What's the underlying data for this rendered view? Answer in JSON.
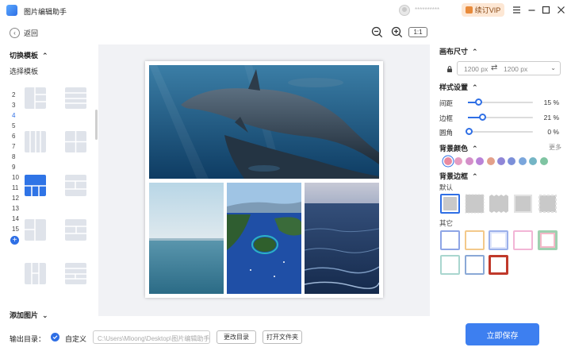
{
  "app": {
    "title": "图片编辑助手",
    "username": "**********",
    "vip_label": "续订VIP"
  },
  "toolbar": {
    "back_label": "返回",
    "ratio_label": "1:1"
  },
  "left_panel": {
    "switch_label": "切换模板",
    "select_label": "选择模板",
    "numbers": [
      "2",
      "3",
      "4",
      "5",
      "6",
      "7",
      "8",
      "9",
      "10",
      "11",
      "12",
      "13",
      "14",
      "15"
    ],
    "active_number": "4",
    "add_picture_label": "添加图片"
  },
  "right_panel": {
    "canvas_size_title": "画布尺寸",
    "width_value": "1200 px",
    "height_value": "1200 px",
    "style_title": "样式设置",
    "sliders": [
      {
        "label": "间距",
        "value": "15 %",
        "fraction": 0.15
      },
      {
        "label": "边框",
        "value": "21 %",
        "fraction": 0.21
      },
      {
        "label": "圆角",
        "value": "0 %",
        "fraction": 0.0
      }
    ],
    "bg_color_title": "背景颜色",
    "more_label": "更多",
    "swatch_colors": [
      "#e98aa0",
      "#e59dc2",
      "#d48fc9",
      "#b983d8",
      "#e3a08a",
      "#8f86d7",
      "#7b8fd9",
      "#7aa6dc",
      "#74b5c5",
      "#7fc4a2"
    ],
    "bg_border_title": "背景边框",
    "default_label": "默认",
    "other_label": "其它"
  },
  "bottom": {
    "output_label": "输出目录：",
    "custom_label": "自定义",
    "path_value": "C:\\Users\\Mloong\\Desktop\\图片编辑助手",
    "change_dir_label": "更改目录",
    "open_folder_label": "打开文件夹",
    "save_label": "立即保存"
  }
}
